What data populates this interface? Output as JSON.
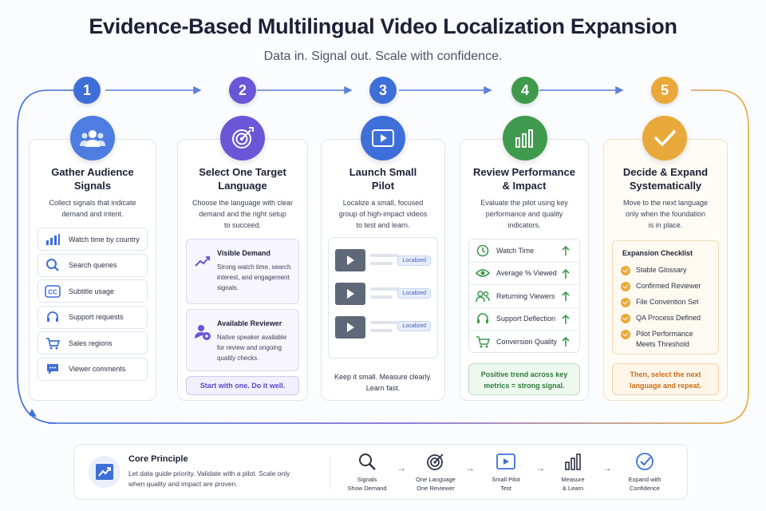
{
  "header": {
    "title": "Evidence-Based Multilingual Video Localization Expansion",
    "subtitle": "Data in. Signal out. Scale with confidence."
  },
  "colors": {
    "step1": "#3e6fd8",
    "step2": "#6a56d6",
    "step3": "#3e6fd8",
    "step4": "#3f9a4e",
    "step5": "#e9a93a"
  },
  "steps": [
    {
      "number": "1",
      "icon": "people-icon",
      "title_line1": "Gather Audience",
      "title_line2": "Signals",
      "desc_line1": "Collect signals that indicate",
      "desc_line2": "demand and intent.",
      "signals": [
        {
          "label": "Watch time by country",
          "icon": "bar-chart-icon"
        },
        {
          "label": "Search queries",
          "icon": "search-icon"
        },
        {
          "label": "Subtitle usage",
          "icon": "cc-icon"
        },
        {
          "label": "Support requests",
          "icon": "headset-icon"
        },
        {
          "label": "Sales regions",
          "icon": "cart-icon"
        },
        {
          "label": "Viewer comments",
          "icon": "comment-icon"
        }
      ]
    },
    {
      "number": "2",
      "icon": "target-icon",
      "title_line1": "Select One Target",
      "title_line2": "Language",
      "desc_line1": "Choose the language with clear",
      "desc_line2": "demand and the right setup",
      "desc_line3": "to succeed.",
      "demand": {
        "title": "Visible Demand",
        "line1": "Strong watch time, search",
        "line2": "interest, and engagement",
        "line3": "signals."
      },
      "reviewer": {
        "title": "Available Reviewer",
        "line1": "Native speaker available",
        "line2": "for review and ongoing",
        "line3": "quality checks."
      },
      "footer": "Start with one. Do it well."
    },
    {
      "number": "3",
      "icon": "video-icon",
      "title_line1": "Launch Small",
      "title_line2": "Pilot",
      "desc_line1": "Localize a small, focused",
      "desc_line2": "group of high-impact videos",
      "desc_line3": "to test and learn.",
      "videos": [
        "Localized",
        "Localized",
        "Localized"
      ],
      "footer_line1": "Keep it small. Measure clearly.",
      "footer_line2": "Learn fast."
    },
    {
      "number": "4",
      "icon": "bar-chart-icon",
      "title_line1": "Review Performance",
      "title_line2": "& Impact",
      "desc_line1": "Evaluate the pilot using key",
      "desc_line2": "performance and quality",
      "desc_line3": "indicators.",
      "metrics": [
        {
          "label": "Watch Time",
          "icon": "clock-icon"
        },
        {
          "label": "Average % Viewed",
          "icon": "eye-icon"
        },
        {
          "label": "Returning Viewers",
          "icon": "users-icon"
        },
        {
          "label": "Support Deflection",
          "icon": "headset-icon"
        },
        {
          "label": "Conversion Quality",
          "icon": "cart-icon"
        }
      ],
      "footer_line1": "Positive trend across key",
      "footer_line2": "metrics = strong signal."
    },
    {
      "number": "5",
      "icon": "check-icon",
      "title_line1": "Decide & Expand",
      "title_line2": "Systematically",
      "desc_line1": "Move to the next language",
      "desc_line2": "only when the foundation",
      "desc_line3": "is in place.",
      "checklist_title": "Expansion Checklist",
      "checklist": [
        "Stable Glossary",
        "Confirmed Reviewer",
        "File Convention Set",
        "QA Process Defined",
        "Pilot Performance"
      ],
      "checklist_last_line2": "Meets Threshold",
      "footer_line1": "Then, select the next",
      "footer_line2": "language and repeat."
    }
  ],
  "principle": {
    "title": "Core Principle",
    "line1": "Let data guide priority. Validate with a pilot. Scale only",
    "line2": "when quality and impact are proven.",
    "flow": [
      {
        "line1": "Signals",
        "line2": "Show Demand",
        "icon": "search-icon"
      },
      {
        "line1": "One Language",
        "line2": "One Reviewer",
        "icon": "target-icon"
      },
      {
        "line1": "Small Pilot",
        "line2": "Test",
        "icon": "video-icon"
      },
      {
        "line1": "Measure",
        "line2": "& Learn",
        "icon": "bar-chart-icon"
      },
      {
        "line1": "Expand with",
        "line2": "Confidence",
        "icon": "check-circle-icon"
      }
    ]
  }
}
